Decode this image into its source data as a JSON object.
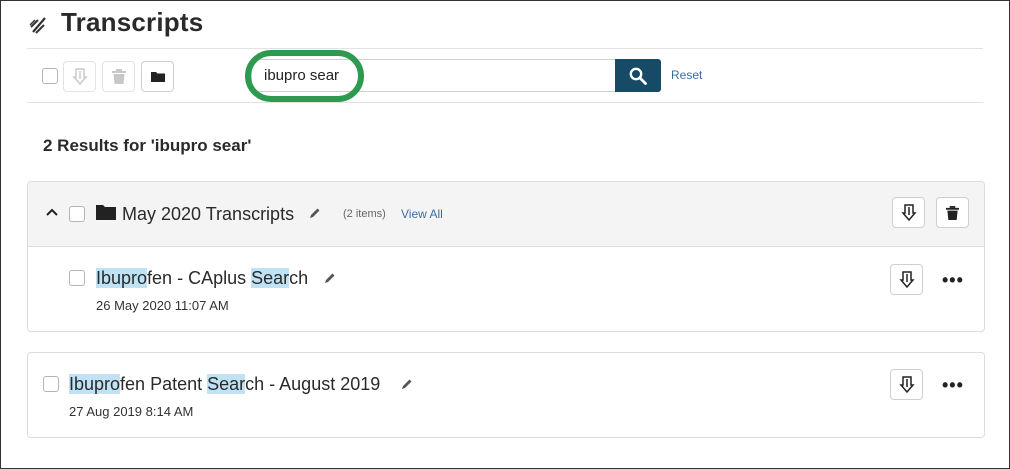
{
  "header": {
    "title": "Transcripts",
    "logo_icon": "transcript-logo-icon"
  },
  "toolbar": {
    "download_icon": "download-icon",
    "delete_icon": "trash-icon",
    "folder_icon": "folder-icon",
    "search_value": "ibupro sear",
    "search_icon": "search-icon",
    "reset_label": "Reset",
    "highlight_color": "#2e9a50",
    "search_button_color": "#174a67"
  },
  "results": {
    "label": "2 Results for 'ibupro sear'"
  },
  "folder": {
    "name": "May 2020 Transcripts",
    "count": "(2 items)",
    "view_all": "View All",
    "items": [
      {
        "title_parts": [
          "Ibupro",
          "fen - CAplus ",
          "Sear",
          "ch"
        ],
        "date": "26 May 2020 11:07 AM"
      }
    ]
  },
  "items": [
    {
      "title_parts": [
        "Ibupro",
        "fen Patent ",
        "Sear",
        "ch - August 2019"
      ],
      "date": "27 Aug 2019 8:14 AM"
    }
  ],
  "more_label": "•••"
}
